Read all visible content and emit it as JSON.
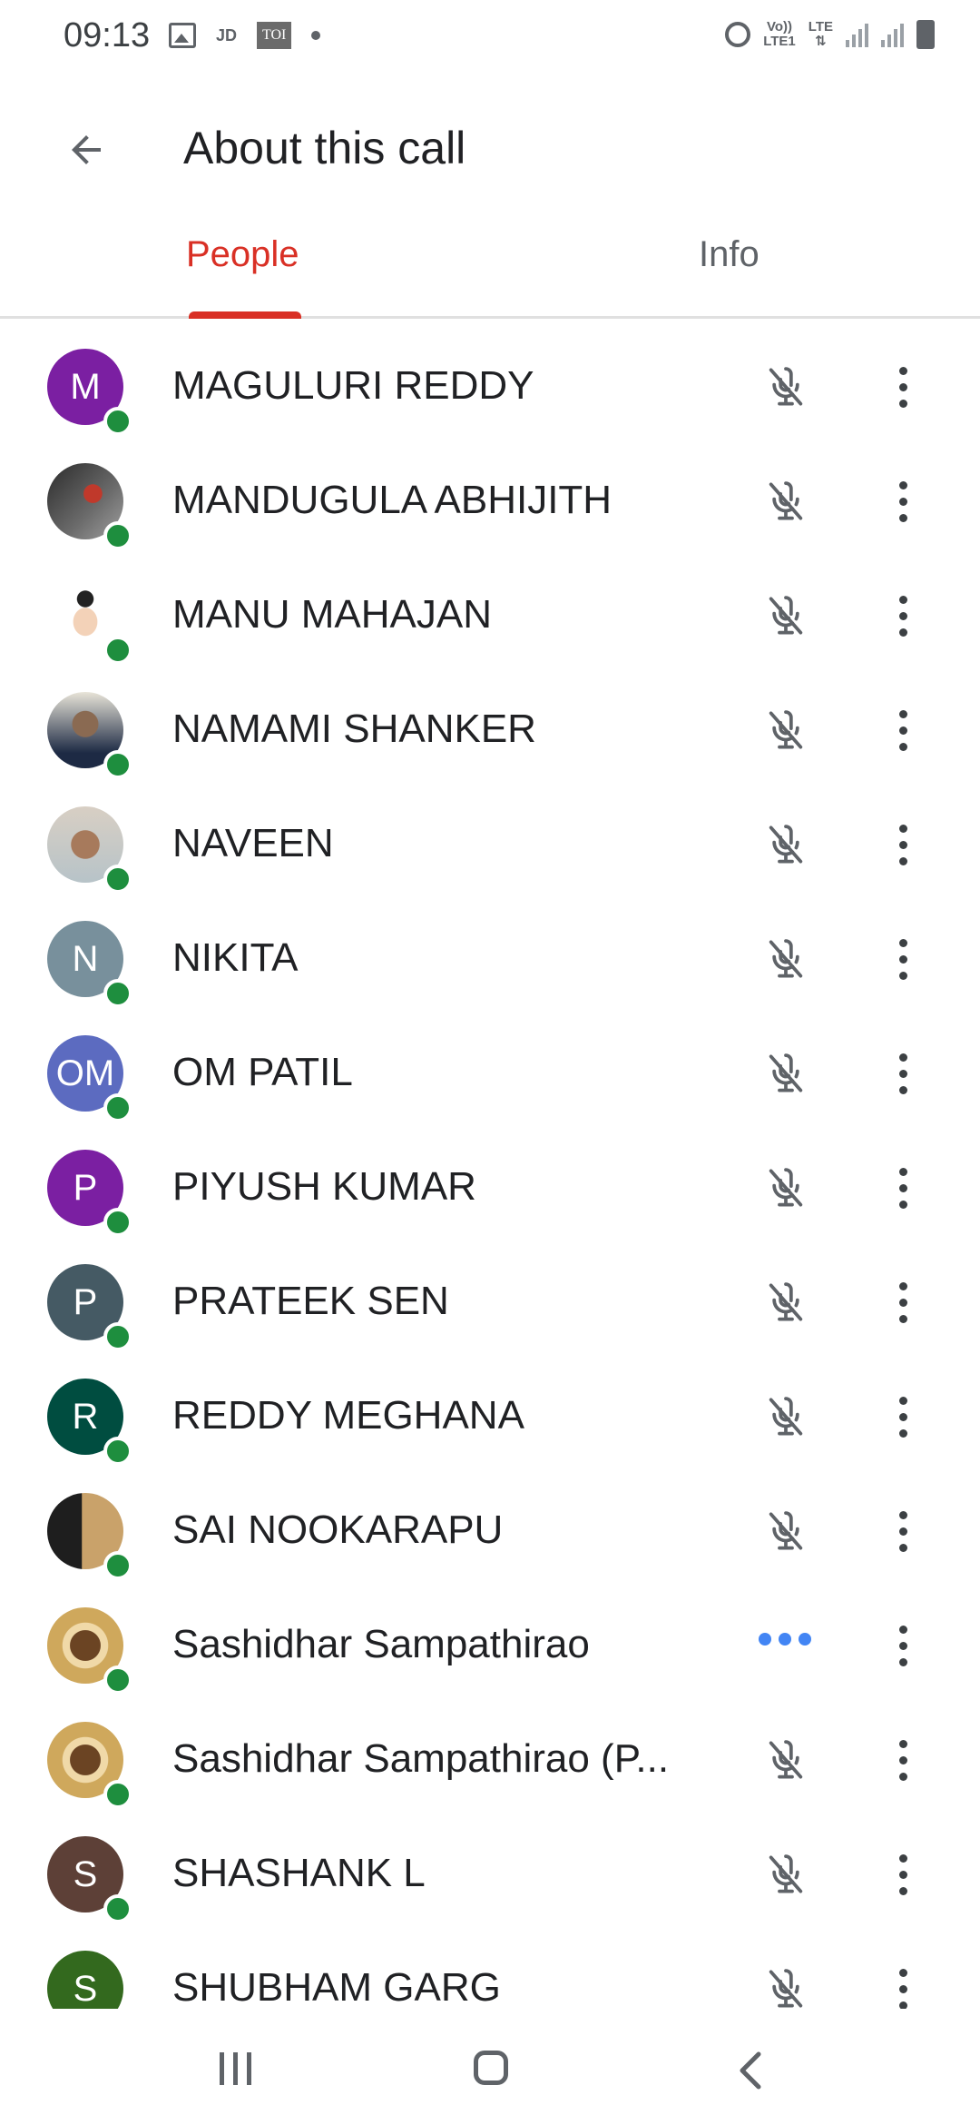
{
  "status_bar": {
    "time": "09:13",
    "left_icons": [
      "image-icon",
      "jd-icon",
      "toi-icon",
      "dot-icon"
    ],
    "jd_label": "JD",
    "toi_label": "TOI",
    "volte_top": "Vo))",
    "volte_bottom": "LTE1",
    "lte_label": "LTE",
    "right_icons": [
      "alarm-icon",
      "volte-icon",
      "lte-icon",
      "signal-icon",
      "signal-icon",
      "battery-icon"
    ]
  },
  "app_bar": {
    "back_icon": "arrow-back-icon",
    "title": "About this call"
  },
  "tabs": [
    {
      "label": "People",
      "selected": true
    },
    {
      "label": "Info",
      "selected": false
    }
  ],
  "colors": {
    "accent": "#d93025",
    "presence": "#1e8e3e",
    "typing": "#4285f4"
  },
  "participants": [
    {
      "name": "MAGULURI REDDY",
      "initials": "M",
      "avatar_color": "#7b1fa2",
      "status": "muted"
    },
    {
      "name": "MANDUGULA ABHIJITH",
      "initials": "",
      "avatar_color": "photo",
      "status": "muted"
    },
    {
      "name": "MANU MAHAJAN",
      "initials": "",
      "avatar_color": "photo",
      "status": "muted"
    },
    {
      "name": "NAMAMI SHANKER",
      "initials": "",
      "avatar_color": "photo",
      "status": "muted"
    },
    {
      "name": "NAVEEN",
      "initials": "",
      "avatar_color": "photo",
      "status": "muted"
    },
    {
      "name": "NIKITA",
      "initials": "N",
      "avatar_color": "#78909c",
      "status": "muted"
    },
    {
      "name": "OM PATIL",
      "initials": "OM",
      "avatar_color": "#5c6bc0",
      "status": "muted"
    },
    {
      "name": "PIYUSH KUMAR",
      "initials": "P",
      "avatar_color": "#7b1fa2",
      "status": "muted"
    },
    {
      "name": "PRATEEK SEN",
      "initials": "P",
      "avatar_color": "#455a64",
      "status": "muted"
    },
    {
      "name": "REDDY MEGHANA",
      "initials": "R",
      "avatar_color": "#004d40",
      "status": "muted"
    },
    {
      "name": "SAI NOOKARAPU",
      "initials": "",
      "avatar_color": "photo",
      "status": "muted"
    },
    {
      "name": "Sashidhar Sampathirao",
      "initials": "",
      "avatar_color": "photo",
      "status": "speaking"
    },
    {
      "name": "Sashidhar Sampathirao (P...",
      "initials": "",
      "avatar_color": "photo",
      "status": "muted"
    },
    {
      "name": "SHASHANK L",
      "initials": "S",
      "avatar_color": "#5d4037",
      "status": "muted"
    },
    {
      "name": "SHUBHAM GARG",
      "initials": "S",
      "avatar_color": "#33691e",
      "status": "muted"
    }
  ],
  "nav_bar": {
    "icons": [
      "recent-apps-icon",
      "home-icon",
      "back-icon"
    ]
  }
}
